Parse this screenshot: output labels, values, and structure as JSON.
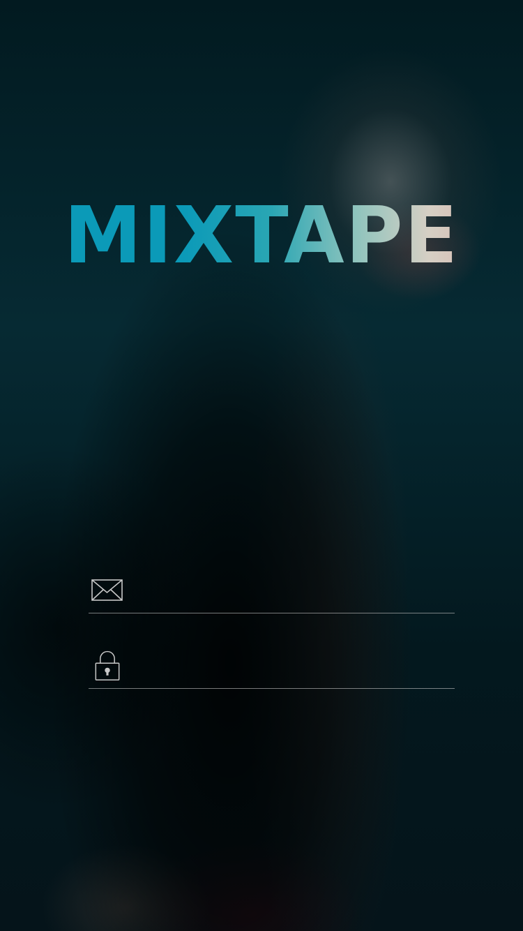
{
  "app": {
    "logo_text": "MIXTAPE"
  },
  "login": {
    "email": {
      "icon": "envelope-icon",
      "value": "",
      "placeholder": ""
    },
    "password": {
      "icon": "lock-icon",
      "value": "",
      "placeholder": ""
    }
  },
  "colors": {
    "background_top": "#021a20",
    "logo_gradient_start": "#0b9ab8",
    "logo_gradient_end": "#d9a8a3",
    "field_line": "#c8c8c8",
    "icon_stroke": "#c8c8c8"
  }
}
